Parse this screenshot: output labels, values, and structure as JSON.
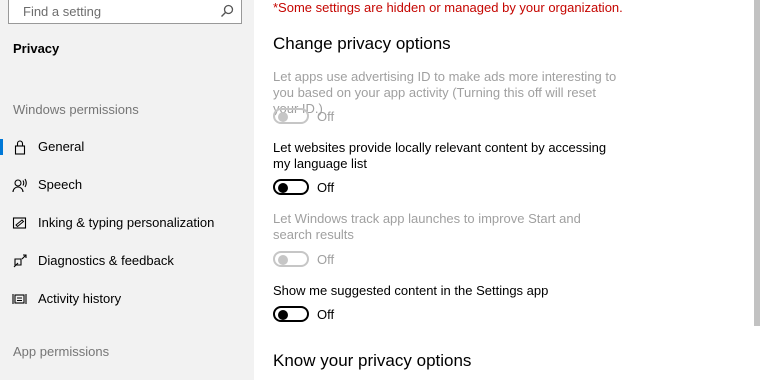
{
  "sidebar": {
    "search": {
      "placeholder": "Find a setting",
      "icon": "search-icon"
    },
    "page_heading": "Privacy",
    "windows_permissions_header": "Windows permissions",
    "items": [
      {
        "label": "General",
        "icon": "lock-icon",
        "selected": true
      },
      {
        "label": "Speech",
        "icon": "speech-icon",
        "selected": false
      },
      {
        "label": "Inking & typing personalization",
        "icon": "inking-icon",
        "selected": false
      },
      {
        "label": "Diagnostics & feedback",
        "icon": "diagnostics-icon",
        "selected": false
      },
      {
        "label": "Activity history",
        "icon": "activity-history-icon",
        "selected": false
      }
    ],
    "app_permissions_header": "App permissions"
  },
  "main": {
    "notice": "*Some settings are hidden or managed by your organization.",
    "section_title": "Change privacy options",
    "settings": [
      {
        "description": "Let apps use advertising ID to make ads more interesting to you based on your app activity (Turning this off will reset your ID.)",
        "state": "Off",
        "enabled": false
      },
      {
        "description": "Let websites provide locally relevant content by accessing my language list",
        "state": "Off",
        "enabled": true
      },
      {
        "description": "Let Windows track app launches to improve Start and search results",
        "state": "Off",
        "enabled": false
      },
      {
        "description": "Show me suggested content in the Settings app",
        "state": "Off",
        "enabled": true
      }
    ],
    "section2_title": "Know your privacy options"
  },
  "colors": {
    "accent": "#0078d7",
    "notice": "#c50500",
    "disabled_text": "#a0a0a0",
    "sidebar_bg": "#f2f2f2"
  }
}
